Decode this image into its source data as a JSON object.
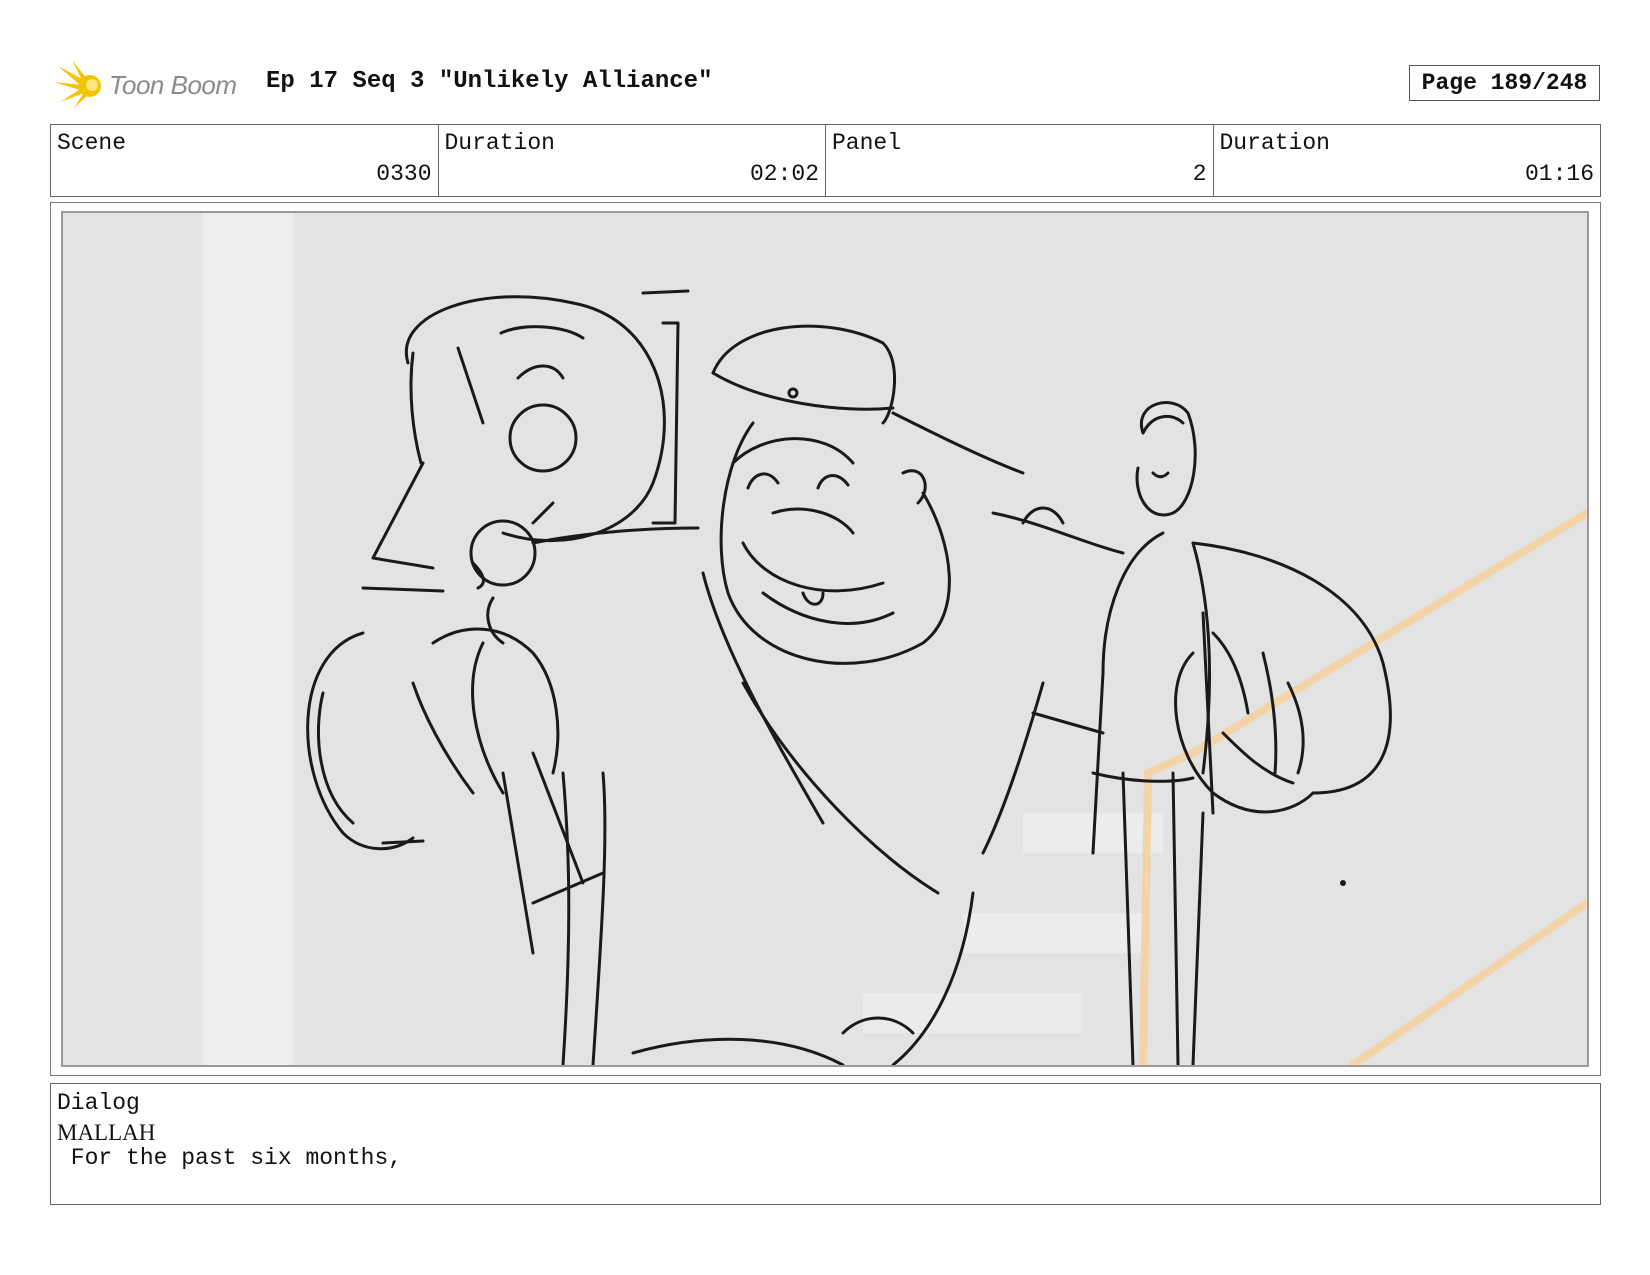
{
  "header": {
    "logo_text": "Toon Boom",
    "title": "Ep 17 Seq 3 \"Unlikely Alliance\"",
    "page": "Page 189/248"
  },
  "info": {
    "scene_label": "Scene",
    "scene_value": "0330",
    "scene_duration_label": "Duration",
    "scene_duration_value": "02:02",
    "panel_label": "Panel",
    "panel_value": "2",
    "panel_duration_label": "Duration",
    "panel_duration_value": "01:16"
  },
  "dialog": {
    "label": "Dialog",
    "speaker": "MALLAH",
    "line": " For the past six months,"
  },
  "colors": {
    "logo_burst": "#f5c400",
    "logo_text": "#8a8a8a",
    "panel_background": "#e3e3e3",
    "sketch_line": "#1a1a1a",
    "light_streak": "#f3d3a8"
  }
}
